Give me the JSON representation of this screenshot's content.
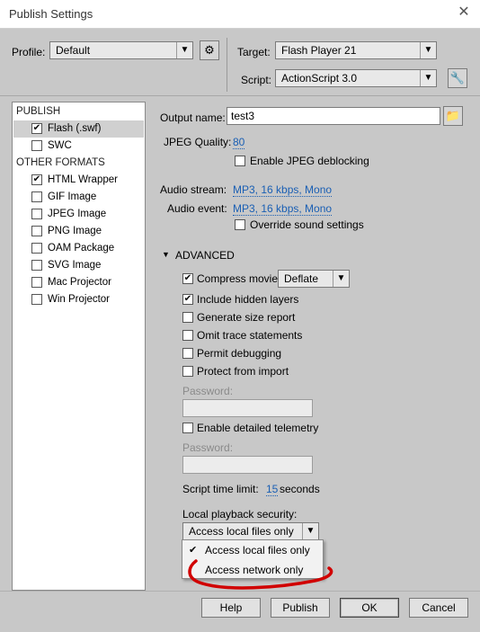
{
  "window": {
    "title": "Publish Settings"
  },
  "profile": {
    "label": "Profile:",
    "value": "Default"
  },
  "target": {
    "label": "Target:",
    "value": "Flash Player 21"
  },
  "script": {
    "label": "Script:",
    "value": "ActionScript 3.0"
  },
  "sidebar": {
    "publish_header": "PUBLISH",
    "other_header": "OTHER FORMATS",
    "items": [
      {
        "label": "Flash (.swf)",
        "checked": true
      },
      {
        "label": "SWC",
        "checked": false
      },
      {
        "label": "HTML Wrapper",
        "checked": true
      },
      {
        "label": "GIF Image",
        "checked": false
      },
      {
        "label": "JPEG Image",
        "checked": false
      },
      {
        "label": "PNG Image",
        "checked": false
      },
      {
        "label": "OAM Package",
        "checked": false
      },
      {
        "label": "SVG Image",
        "checked": false
      },
      {
        "label": "Mac Projector",
        "checked": false
      },
      {
        "label": "Win Projector",
        "checked": false
      }
    ]
  },
  "output": {
    "label": "Output name:",
    "value": "test3"
  },
  "jpeg": {
    "label": "JPEG Quality:",
    "value": "80",
    "deblock_label": "Enable JPEG deblocking"
  },
  "audio": {
    "stream_label": "Audio stream:",
    "stream_value": "MP3, 16 kbps, Mono",
    "event_label": "Audio event:",
    "event_value": "MP3, 16 kbps, Mono",
    "override_label": "Override sound settings"
  },
  "advanced": {
    "header": "ADVANCED",
    "compress_label": "Compress movie",
    "compress_value": "Deflate",
    "options": [
      {
        "label": "Include hidden layers",
        "checked": true
      },
      {
        "label": "Generate size report",
        "checked": false
      },
      {
        "label": "Omit trace statements",
        "checked": false
      },
      {
        "label": "Permit debugging",
        "checked": false
      },
      {
        "label": "Protect from import",
        "checked": false
      }
    ],
    "password_label": "Password:",
    "telemetry_label": "Enable detailed telemetry",
    "password2_label": "Password:",
    "time_limit_label": "Script time limit:",
    "time_limit_value": "15",
    "time_limit_unit": "seconds",
    "security_label": "Local playback security:",
    "security_value": "Access local files only",
    "security_options": [
      {
        "label": "Access local files only",
        "selected": true
      },
      {
        "label": "Access network only",
        "selected": false
      }
    ]
  },
  "buttons": {
    "help": "Help",
    "publish": "Publish",
    "ok": "OK",
    "cancel": "Cancel"
  },
  "annotation": {
    "color": "#d10000"
  }
}
